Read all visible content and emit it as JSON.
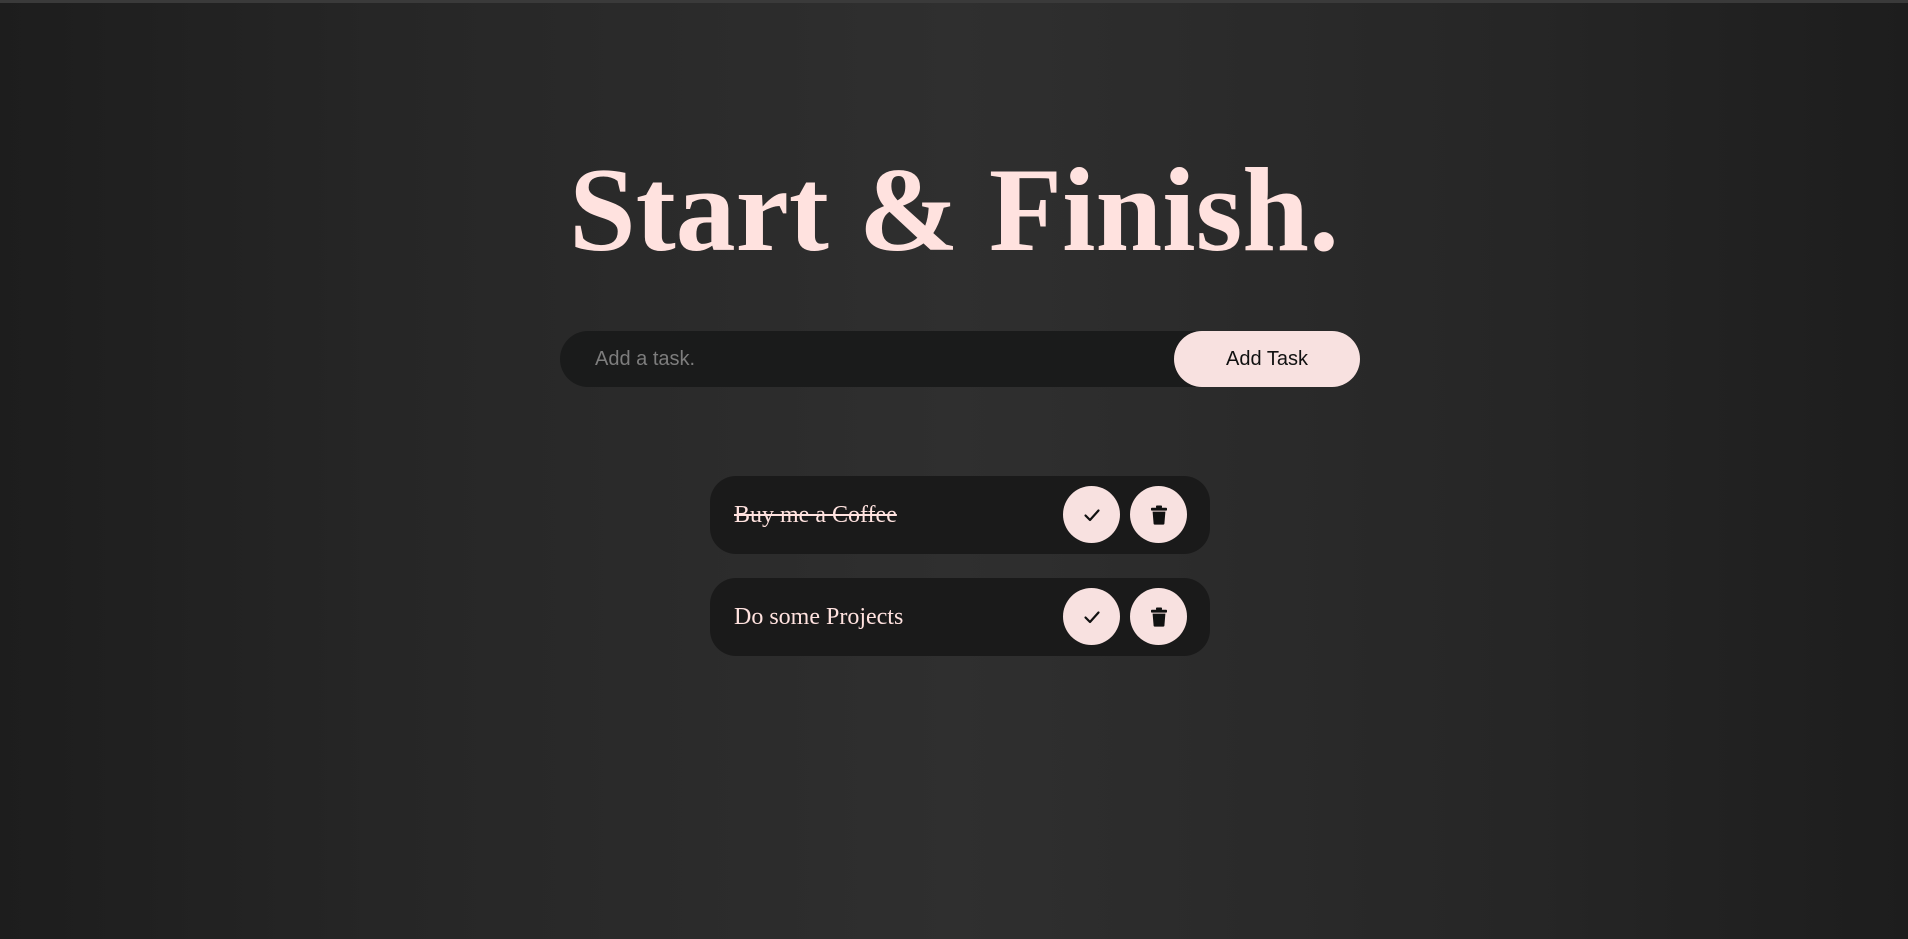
{
  "app": {
    "title": "Start & Finish."
  },
  "form": {
    "placeholder": "Add a task.",
    "value": "",
    "add_button_label": "Add Task"
  },
  "tasks": [
    {
      "text": "Buy me a Coffee",
      "completed": true
    },
    {
      "text": "Do some Projects",
      "completed": false
    }
  ],
  "icons": {
    "complete": "check-icon",
    "delete": "trash-icon"
  },
  "colors": {
    "accent": "#ffe2df",
    "button_bg": "#f8e1e0",
    "panel_bg": "#1a1a1a"
  }
}
